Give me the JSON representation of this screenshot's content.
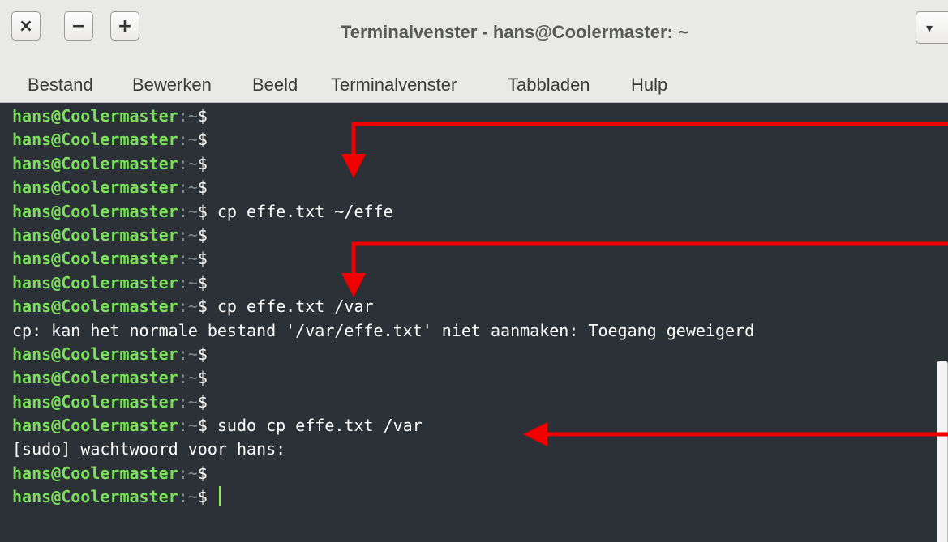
{
  "window": {
    "title": "Terminalvenster - hans@Coolermaster: ~",
    "buttons": {
      "close": "×",
      "minimize": "−",
      "maximize": "+",
      "menu": "▾"
    }
  },
  "menubar": {
    "items": [
      "Bestand",
      "Bewerken",
      "Beeld",
      "Terminalvenster",
      "Tabbladen",
      "Hulp"
    ]
  },
  "terminal": {
    "prompt_user": "hans@Coolermaster",
    "prompt_path": ":~",
    "prompt_sign": "$",
    "lines": [
      {
        "type": "prompt",
        "cmd": ""
      },
      {
        "type": "prompt",
        "cmd": ""
      },
      {
        "type": "prompt",
        "cmd": ""
      },
      {
        "type": "prompt",
        "cmd": ""
      },
      {
        "type": "prompt",
        "cmd": " cp effe.txt ~/effe"
      },
      {
        "type": "prompt",
        "cmd": ""
      },
      {
        "type": "prompt",
        "cmd": ""
      },
      {
        "type": "prompt",
        "cmd": ""
      },
      {
        "type": "prompt",
        "cmd": " cp effe.txt /var"
      },
      {
        "type": "output",
        "text": "cp: kan het normale bestand '/var/effe.txt' niet aanmaken: Toegang geweigerd"
      },
      {
        "type": "prompt",
        "cmd": ""
      },
      {
        "type": "prompt",
        "cmd": ""
      },
      {
        "type": "prompt",
        "cmd": ""
      },
      {
        "type": "prompt",
        "cmd": " sudo cp effe.txt /var"
      },
      {
        "type": "output",
        "text": "[sudo] wachtwoord voor hans:"
      },
      {
        "type": "prompt",
        "cmd": ""
      },
      {
        "type": "prompt",
        "cmd": " ",
        "cursor": true
      }
    ]
  },
  "colors": {
    "terminal_bg": "#2b3136",
    "prompt_user": "#7ae05a",
    "prompt_path": "#7f8b8c",
    "annotation_arrow": "#f00000"
  },
  "annotations": [
    "red-arrow",
    "red-arrow",
    "red-arrow"
  ]
}
